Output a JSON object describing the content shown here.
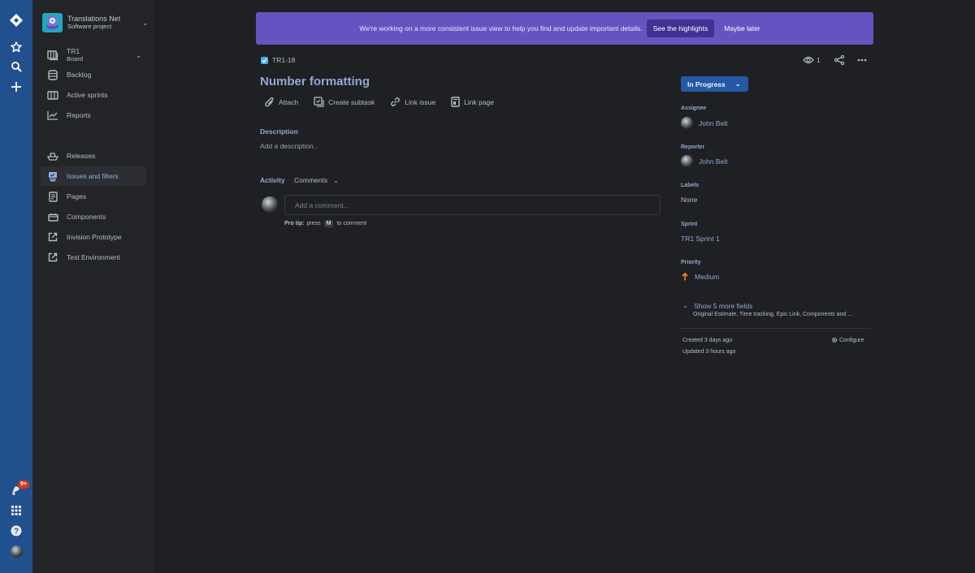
{
  "global_nav": {
    "notifications_badge": "9+"
  },
  "sidebar": {
    "project": {
      "name": "Translations Net",
      "type": "Software project"
    },
    "board": {
      "name": "TR1",
      "type": "Board"
    },
    "items": [
      {
        "label": "Backlog",
        "icon": "backlog-icon"
      },
      {
        "label": "Active sprints",
        "icon": "active-sprints-icon"
      },
      {
        "label": "Reports",
        "icon": "reports-icon"
      },
      {
        "label": "Releases",
        "icon": "releases-icon"
      },
      {
        "label": "Issues and filters",
        "icon": "issues-icon",
        "active": true
      },
      {
        "label": "Pages",
        "icon": "pages-icon"
      },
      {
        "label": "Components",
        "icon": "components-icon"
      },
      {
        "label": "Invision Prototype",
        "icon": "external-link-icon"
      },
      {
        "label": "Test Environment",
        "icon": "external-link-icon"
      }
    ]
  },
  "banner": {
    "message": "We're working on a more consistent issue view to help you find and update important details.",
    "primary_label": "See the highlights",
    "secondary_label": "Maybe later",
    "color": "#6554c0"
  },
  "issue": {
    "key": "TR1-18",
    "title": "Number formatting",
    "actions": [
      "Attach",
      "Create subtask",
      "Link issue",
      "Link page"
    ],
    "description_label": "Description",
    "description_placeholder": "Add a description...",
    "activity_label": "Activity",
    "activity_filter": "Comments",
    "comment_placeholder": "Add a comment...",
    "protip_label": "Pro tip:",
    "protip_press": "press",
    "protip_key": "M",
    "protip_suffix": "to comment"
  },
  "details": {
    "watchers_count": "1",
    "status": "In Progress",
    "status_color": "#2658a5",
    "assignee_label": "Assignee",
    "assignee": "John Belt",
    "reporter_label": "Reporter",
    "reporter": "John Belt",
    "labels_label": "Labels",
    "labels": "None",
    "sprint_label": "Sprint",
    "sprint": "TR1 Sprint 1",
    "priority_label": "Priority",
    "priority": "Medium",
    "priority_color": "#ff8b00",
    "more_fields_label": "Show 5 more fields",
    "more_fields_sub": "Original Estimate, Time tracking, Epic Link, Components and ...",
    "created": "Created 3 days ago",
    "updated": "Updated 3 hours ago",
    "configure_label": "Configure"
  }
}
